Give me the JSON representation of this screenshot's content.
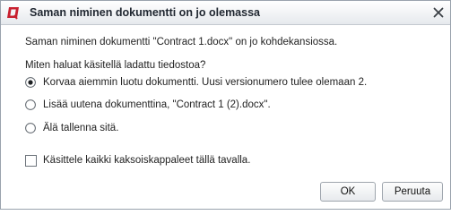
{
  "dialog": {
    "title": "Saman niminen dokumentti on jo olemassa",
    "message": "Saman niminen dokumentti \"Contract 1.docx\" on jo kohdekansiossa.",
    "question": "Miten haluat käsitellä ladattu tiedostoa?",
    "options": [
      {
        "label": "Korvaa aiemmin luotu dokumentti. Uusi versionumero tulee olemaan 2.",
        "selected": true
      },
      {
        "label": "Lisää uutena dokumenttina, \"Contract 1 (2).docx\".",
        "selected": false
      },
      {
        "label": "Älä tallenna sitä.",
        "selected": false
      }
    ],
    "apply_all_label": "Käsittele kaikki kaksoiskappaleet tällä tavalla.",
    "apply_all_checked": false,
    "ok_label": "OK",
    "cancel_label": "Peruuta"
  },
  "colors": {
    "brand_icon": "#c8202f",
    "titlebar_top": "#ffffff",
    "titlebar_bottom": "#e6e9ed",
    "border": "#9aa3ad"
  },
  "icons": {
    "app": "app-logo-icon",
    "close": "close-icon",
    "radio_on": "radio-selected-icon",
    "radio_off": "radio-unselected-icon"
  }
}
